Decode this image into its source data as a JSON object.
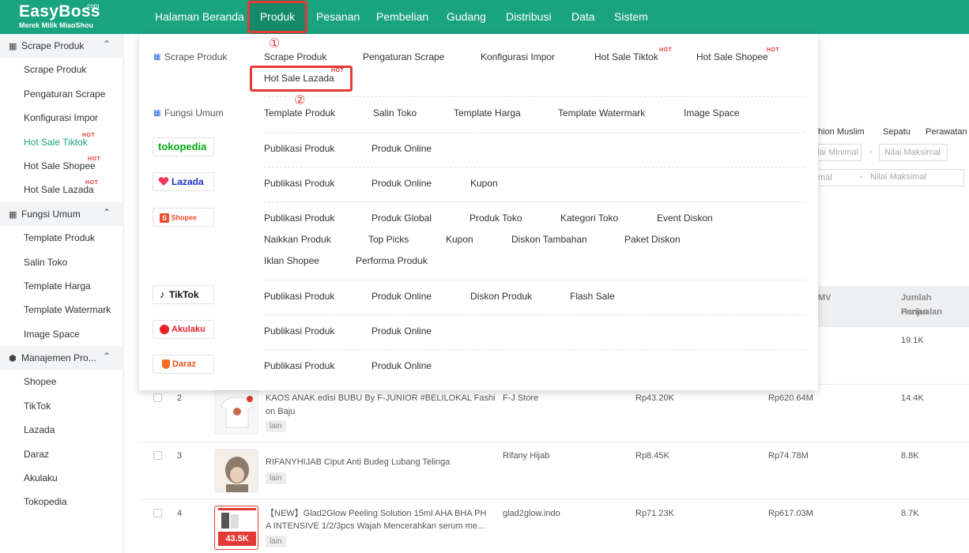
{
  "logo": {
    "brand": "EasyBoss",
    "com": ".com",
    "sub": "Merek Milik MiaoShou"
  },
  "nav": [
    "Halaman Beranda",
    "Produk",
    "Pesanan",
    "Pembelian",
    "Gudang",
    "Distribusi",
    "Data",
    "Sistem"
  ],
  "hot_label": "HOT",
  "sidebar": {
    "groups": [
      {
        "label": "Scrape Produk",
        "items": [
          "Scrape Produk",
          "Pengaturan Scrape",
          "Konfigurasi Impor",
          "Hot Sale Tiktok",
          "Hot Sale Shopee",
          "Hot Sale Lazada"
        ]
      },
      {
        "label": "Fungsi Umum",
        "items": [
          "Template Produk",
          "Salin Toko",
          "Template Harga",
          "Template Watermark",
          "Image Space"
        ]
      },
      {
        "label": "Manajemen Pro...",
        "items": [
          "Shopee",
          "TikTok",
          "Lazada",
          "Daraz",
          "Akulaku",
          "Tokopedia"
        ]
      }
    ]
  },
  "bg": {
    "tags": [
      "hion Muslim",
      "Sepatu",
      "Perawatan"
    ],
    "range1": {
      "min": "lai Minimal",
      "sep": "-",
      "max": "Nilai Maksimal"
    },
    "range2": {
      "min": "mal",
      "sep": "-",
      "max": "Nilai Maksimal"
    },
    "columns": [
      "MV",
      "Jumlah Penjualan",
      "Harian"
    ],
    "row1_daily": "19.1K",
    "rows": [
      {
        "no": "2",
        "title": "KAOS ANAK.edisi BUBU By F-JUNIOR #BELILOKAL Fashi",
        "title2": "on Baju",
        "tag": "lain",
        "shop": "F-J Store",
        "price": "Rp43.20K",
        "gmv": "Rp620.64M",
        "daily": "14.4K"
      },
      {
        "no": "3",
        "title": "RIFANYHIJAB Ciput Anti Budeg Lubang Telinga",
        "title2": "",
        "tag": "lain",
        "shop": "Rifany Hijab",
        "price": "Rp8.45K",
        "gmv": "Rp74.78M",
        "daily": "8.8K"
      },
      {
        "no": "4",
        "title": "【NEW】Glad2Glow Peeling Solution 15ml AHA BHA PH",
        "title2": "A INTENSIVE 1/2/3pcs Wajah Mencerahkan serum me...",
        "tag": "lain",
        "shop": "glad2glow.indo",
        "price": "Rp71.23K",
        "gmv": "Rp617.03M",
        "daily": "8.7K"
      }
    ],
    "thumb4_text": "43.5K"
  },
  "dropdown": {
    "scrape": {
      "label": "Scrape Produk",
      "links": [
        "Scrape Produk",
        "Pengaturan Scrape",
        "Konfigurasi Impor",
        "Hot Sale Tiktok",
        "Hot Sale Shopee",
        "Hot Sale Lazada"
      ]
    },
    "fungsi": {
      "label": "Fungsi Umum",
      "links": [
        "Template Produk",
        "Salin Toko",
        "Template Harga",
        "Template Watermark",
        "Image Space"
      ]
    },
    "tokopedia": {
      "logo": "tokopedia",
      "links": [
        "Publikasi Produk",
        "Produk Online"
      ]
    },
    "lazada": {
      "logo": "Lazada",
      "links": [
        "Publikasi Produk",
        "Produk Online",
        "Kupon"
      ]
    },
    "shopee": {
      "logo": "Shopee",
      "links": [
        "Publikasi Produk",
        "Produk Global",
        "Produk Toko",
        "Kategori Toko",
        "Event Diskon",
        "Naikkan Produk",
        "Top Picks",
        "Kupon",
        "Diskon Tambahan",
        "Paket Diskon",
        "Iklan Shopee",
        "Performa Produk"
      ]
    },
    "tiktok": {
      "logo": "TikTok",
      "links": [
        "Publikasi Produk",
        "Produk Online",
        "Diskon Produk",
        "Flash Sale"
      ]
    },
    "akulaku": {
      "logo": "Akulaku",
      "links": [
        "Publikasi Produk",
        "Produk Online"
      ]
    },
    "daraz": {
      "logo": "Daraz",
      "links": [
        "Publikasi Produk",
        "Produk Online"
      ]
    }
  },
  "annotations": {
    "step1": "①",
    "step2": "②"
  },
  "colors": {
    "primary": "#1aa37f",
    "highlight": "#e53935",
    "lazada": "#1a2ecb",
    "shopee": "#ee4d2d",
    "tokopedia": "#03ac0e",
    "akulaku": "#e8212a",
    "daraz": "#f36f21"
  }
}
